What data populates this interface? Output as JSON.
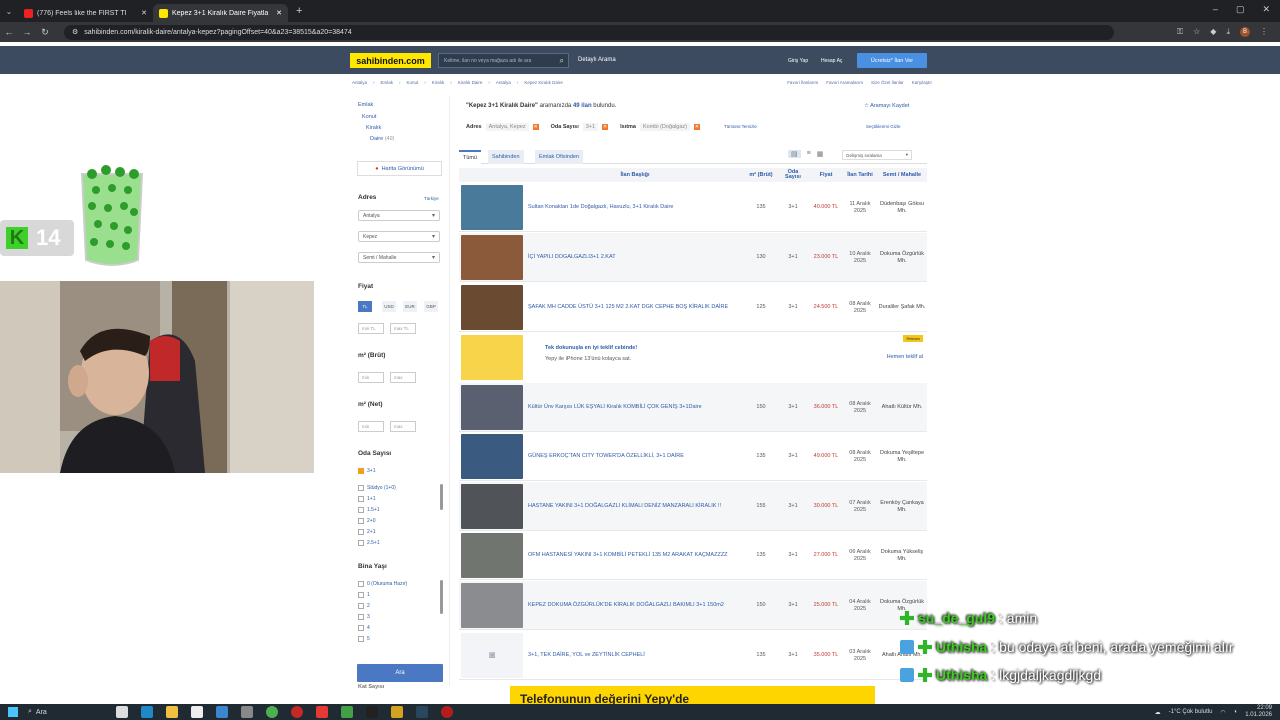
{
  "browser": {
    "tabs": [
      {
        "title": "(776) Feels like the FIRST TI",
        "favicon": "#e22"
      },
      {
        "title": "Kepez 3+1 Kiralık Daire Fiyatla",
        "favicon": "#ffe800"
      }
    ],
    "new_tab": "+",
    "url": "sahibinden.com/kiralik-daire/antalya-kepez?pagingOffset=40&a23=38515&a20=38474"
  },
  "site": {
    "logo": "sahibinden.com",
    "search_placeholder": "Kelime, ilan no veya mağaza adı ile ara",
    "detayli": "Detaylı Arama",
    "giris": "Giriş Yap",
    "hesap": "Hesap Aç",
    "ucretsiz": "Ücretsiz* İlan Ver",
    "breadcrumb": [
      "Antalya",
      "Emlak",
      "Konut",
      "Kiralık",
      "Kiralık Daire",
      "Antalya",
      "Kepez Kiralık Daire"
    ],
    "top_links": [
      "Favori İlanlarım",
      "Favori Aramalarım",
      "Size Özel İlanlar",
      "Karşılaştır"
    ]
  },
  "sidebar": {
    "cats": [
      "Emlak",
      "Konut",
      "Kiralık",
      "Daire"
    ],
    "daire_count": "(49)",
    "harita": "Harita Görünümü",
    "adres": "Adres",
    "turkiye": "Türkiye",
    "il": "Antalya",
    "ilce": "Kepez",
    "mahalle": "Semt / Mahalle",
    "fiyat": "Fiyat",
    "currencies": [
      "TL",
      "USD",
      "EUR",
      "GBP"
    ],
    "min_tl": "min TL",
    "max_tl": "max TL",
    "brut": "m² (Brüt)",
    "net": "m² (Net)",
    "min": "min",
    "max": "max",
    "oda": "Oda Sayısı",
    "oda_opts": [
      "3+1",
      "Stüdyo (1+0)",
      "1+1",
      "1.5+1",
      "2+0",
      "2+1",
      "2.5+1"
    ],
    "bina": "Bina Yaşı",
    "bina_opts": [
      "0 (Oturuma Hazır)",
      "1",
      "2",
      "3",
      "4",
      "5"
    ],
    "ara": "Ara",
    "kat": "Kat Sayısı"
  },
  "results": {
    "query": "\"Kepez 3+1 Kiralık Daire\"",
    "aramanizda": "aramanızda",
    "count": "49 ilan",
    "bulundu": "bulundu.",
    "kaydet": "☆ Aramayı Kaydet",
    "filters": [
      {
        "label": "Adres",
        "value": "Antalya, Kepez"
      },
      {
        "label": "Oda Sayısı",
        "value": "3+1"
      },
      {
        "label": "Isıtma",
        "value": "Kombi (Doğalgaz)"
      }
    ],
    "temizle": "Tümünü Temizle",
    "gizle": "Seçtiklerimi Gizle",
    "tabs": [
      "Tümü",
      "Sahibinden",
      "Emlak Ofisinden"
    ],
    "sort": "Gelişmiş sıralama",
    "headers": {
      "title": "İlan Başlığı",
      "m2": "m² (Brüt)",
      "oda": "Oda Sayısı",
      "fiyat": "Fiyat",
      "tarih": "İlan Tarihi",
      "semt": "Semt / Mahalle"
    },
    "ad": {
      "line1": "Tek dokunuşla en iyi teklif cebinde!",
      "line2": "Yepy ile iPhone 13'ünü kolayca sat.",
      "badge": "Reklam",
      "link": "Hemen teklif al"
    },
    "listings": [
      {
        "title": "Sultan Konakları 1de Doğalgazlı, Havuzlu, 3+1 Kiralık Daire",
        "m2": "135",
        "oda": "3+1",
        "fiyat": "40.000 TL",
        "tarih": "11 Aralık 2025",
        "semt": "Düdenbaşı Göksu Mh.",
        "thumb": "#4a7a9a"
      },
      {
        "title": "İÇİ YAPILI DOGALGAZLI3+1 2.KAT",
        "m2": "130",
        "oda": "3+1",
        "fiyat": "23.000 TL",
        "tarih": "10 Aralık 2025",
        "semt": "Dokuma Özgürlük Mh.",
        "thumb": "#8a5a3a"
      },
      {
        "title": "ŞAFAK MH CADDE ÜSTÜ 3+1 125 M2 2.KAT DGK CEPHE BOŞ KİRALIK DAİRE",
        "m2": "125",
        "oda": "3+1",
        "fiyat": "24.500 TL",
        "tarih": "08 Aralık 2025",
        "semt": "Duraliler Şafak Mh.",
        "thumb": "#6a4a30"
      },
      {
        "title": "Kültür Ünv Karşısı LÜK EŞYALI Kiralık KOMBİLİ ÇOK GENİŞ 3+1Daire",
        "m2": "150",
        "oda": "3+1",
        "fiyat": "36.000 TL",
        "tarih": "08 Aralık 2025",
        "semt": "Ahatlı Kültür Mh.",
        "thumb": "#5a6070"
      },
      {
        "title": "GÜNEŞ ERKOÇ'TAN CITY TOWER'DA ÖZELLİKLİ, 3+1 DAİRE",
        "m2": "135",
        "oda": "3+1",
        "fiyat": "49.000 TL",
        "tarih": "08 Aralık 2025",
        "semt": "Dokuma Yeşiltepe Mh.",
        "thumb": "#3a5a80"
      },
      {
        "title": "HASTANE YAKINI 3+1 DOĞALGAZLI KLİMALI DENİZ MANZARALI KİRALIK !!",
        "m2": "155",
        "oda": "3+1",
        "fiyat": "30.000 TL",
        "tarih": "07 Aralık 2025",
        "semt": "Erenköy Çankaya Mh.",
        "thumb": "#505458"
      },
      {
        "title": "OFM HASTANESİ YAKINI 3+1 KOMBİLİ PETEKLİ 135 M2 ARAKAT KAÇMAZZZZ",
        "m2": "135",
        "oda": "3+1",
        "fiyat": "27.000 TL",
        "tarih": "06 Aralık 2025",
        "semt": "Dokuma Yükseliş Mh.",
        "thumb": "#707570"
      },
      {
        "title": "KEPEZ DOKUMA ÖZGÜRLÜK'DE KİRALIK DOĞALGAZLI BAKIMLI 3+1 150m2",
        "m2": "150",
        "oda": "3+1",
        "fiyat": "25.000 TL",
        "tarih": "04 Aralık 2025",
        "semt": "Dokuma Özgürlük Mh.",
        "thumb": "#8a8c90"
      },
      {
        "title": "3+1, TEK DAİRE, YOL ve ZEYTİNLİK CEPHELİ",
        "m2": "135",
        "oda": "3+1",
        "fiyat": "35.000 TL",
        "tarih": "03 Aralık 2025",
        "semt": "Ahatlı Ahatlı Mh.",
        "thumb": "#f2f4f7"
      }
    ],
    "banner": "Telefonunun değerini Yepy'de"
  },
  "stream": {
    "score": "14",
    "k": "K",
    "chat": [
      {
        "user": "su_de_gul9",
        "msg": ": amin"
      },
      {
        "user": "Uthisha",
        "msg": ": bu odaya at beni, arada yemeğimi alır"
      },
      {
        "user": "Uthisha",
        "msg": ": lkgjdaljkagdljkgd"
      }
    ]
  },
  "taskbar": {
    "search": "Ara",
    "weather": "-1°C  Çok bulutlu",
    "time": "22:09",
    "date": "1.01.2026"
  }
}
